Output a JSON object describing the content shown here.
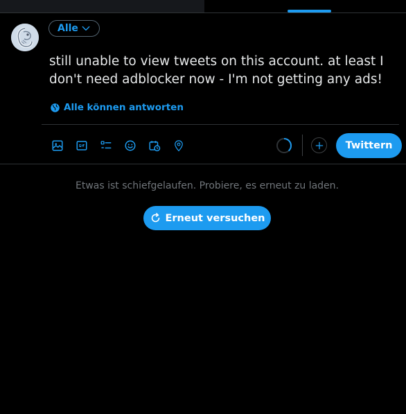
{
  "composer": {
    "audience_label": "Alle",
    "tweet_text": "still unable to view tweets on this account. at least I don't need adblocker now - I'm not getting any ads!",
    "reply_setting_label": "Alle können antworten",
    "tweet_button_label": "Twittern"
  },
  "toolbar_icons": [
    "image-icon",
    "gif-icon",
    "poll-icon",
    "emoji-icon",
    "schedule-icon",
    "location-icon"
  ],
  "timeline": {
    "error_message": "Etwas ist schiefgelaufen. Probiere, es erneut zu laden.",
    "retry_label": "Erneut versuchen"
  },
  "colors": {
    "accent": "#1d9bf0",
    "background": "#000000",
    "text_primary": "#e7e9ea",
    "text_secondary": "#71767b",
    "border": "#2f3336"
  }
}
